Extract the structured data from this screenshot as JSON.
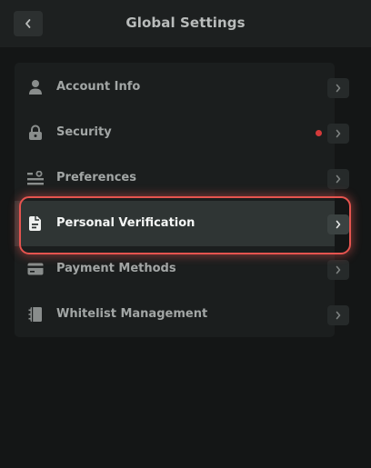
{
  "header": {
    "title": "Global Settings",
    "back_icon": "chevron-left-icon"
  },
  "menu": {
    "items": [
      {
        "label": "Account Info",
        "icon": "user-icon"
      },
      {
        "label": "Security",
        "icon": "lock-icon",
        "has_alert_dot": true
      },
      {
        "label": "Preferences",
        "icon": "sliders-icon"
      },
      {
        "label": "Personal Verification",
        "icon": "document-icon",
        "active": true
      },
      {
        "label": "Payment Methods",
        "icon": "credit-card-icon"
      },
      {
        "label": "Whitelist Management",
        "icon": "notebook-icon"
      }
    ]
  },
  "colors": {
    "highlight": "#e5544f",
    "alert_dot": "#d43a3a",
    "background": "#141616"
  }
}
